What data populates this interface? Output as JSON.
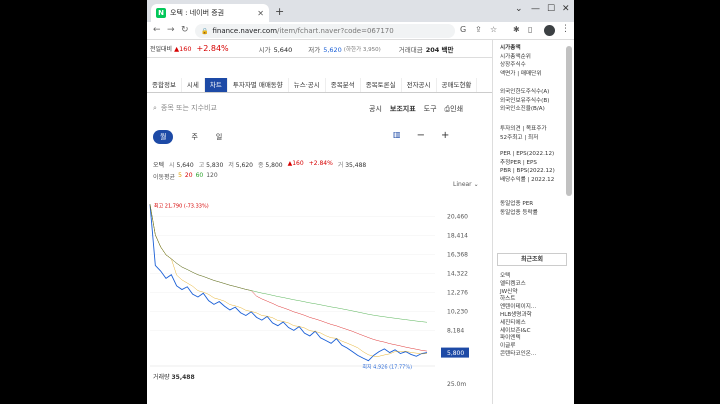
{
  "browser": {
    "tab_title": "오텍 : 네이버 증권",
    "favicon": "N",
    "url_host": "finance.naver.com",
    "url_path": "/item/fchart.naver?code=067170"
  },
  "stock_header": {
    "prev_label": "전일대비",
    "change_arrow": "▲",
    "change_value": "160",
    "change_pct": "+2.84%",
    "high_label": "시가",
    "high_value": "5,640",
    "low_label": "저가",
    "low_value": "5,620",
    "low_sub": "(하한가 3,950)",
    "volume_label": "거래대금",
    "volume_value": "204 백만"
  },
  "tabs": [
    "종합정보",
    "시세",
    "차트",
    "투자자별 매매동향",
    "뉴스·공시",
    "종목분석",
    "종목토론실",
    "전자공시",
    "공매도현황"
  ],
  "search": {
    "placeholder": "종목 또는 지수비교"
  },
  "toolbar": {
    "disclosure": "공시",
    "indicator": "보조지표",
    "tools": "도구",
    "print": "인쇄"
  },
  "period": {
    "month": "월",
    "week": "주",
    "day": "일"
  },
  "ohlc": {
    "name": "오텍",
    "open_label": "시",
    "open": "5,640",
    "high_label": "고",
    "high": "5,830",
    "low_label": "저",
    "low": "5,620",
    "close_label": "종",
    "close": "5,800",
    "change": "▲160",
    "change_pct": "+2.84%",
    "vol_label": "거",
    "vol": "35,488"
  },
  "ma": {
    "label": "이동평균",
    "p5": "5",
    "p20": "20",
    "p60": "60",
    "p120": "120"
  },
  "linear_label": "Linear",
  "volume_label": "거래량",
  "volume_value": "35,488",
  "colors": {
    "accent": "#1d4aa6",
    "up": "#d60000",
    "down": "#1a5fd6",
    "price_line": "#1a5fd6"
  },
  "chart_data": {
    "type": "line",
    "scale": "linear",
    "y_ticks": [
      20460,
      18414,
      16368,
      14322,
      12276,
      10230,
      8184
    ],
    "ylim": [
      5000,
      22800
    ],
    "current_price": "5,800",
    "max_annotation": "최고 21,790 (-73.33%)",
    "min_annotation": "최저 4,926 (17.77%)",
    "volume_tick": "25.0m",
    "series": [
      {
        "values": [
          21790,
          15200,
          14600,
          13800,
          14200,
          13000,
          12600,
          12900,
          12100,
          11800,
          12200,
          11400,
          11000,
          11300,
          10800,
          10400,
          10700,
          10100,
          9800,
          10200,
          9600,
          9300,
          9700,
          9000,
          8700,
          9100,
          8500,
          8200,
          8600,
          7900,
          7600,
          8100,
          7400,
          7100,
          6800,
          7300,
          6600,
          6300,
          5900,
          5500,
          5200,
          4926,
          5500,
          5900,
          6200,
          5800,
          6100,
          5700,
          5900,
          5600,
          5400,
          5700,
          5800
        ]
      }
    ]
  },
  "sidebar": {
    "block1": [
      "시가총액",
      "시가총액순위",
      "상장주식수",
      "액면가 | 매매단위"
    ],
    "block2": [
      "외국인한도주식수(A)",
      "외국인보유주식수(B)",
      "외국인소진율(B/A)"
    ],
    "block3": [
      "투자의견 | 목표주가",
      "52주최고 | 최저"
    ],
    "block4": [
      "PER | EPS(2022.12)",
      "추정PER | EPS",
      "PBR | BPS(2022.12)",
      "배당수익률 | 2022.12"
    ],
    "block5": [
      "동일업종 PER",
      "동일업종 등락률"
    ],
    "recent_title": "최근조회",
    "recent_items": [
      "오텍",
      "엘티켐코스",
      "JW신약",
      "하스트",
      "엔텐이테이지...",
      "HLB생명과학",
      "세진티에스",
      "세이브존I&C",
      "파이엔텍",
      "이글루",
      "콘텐타코인온..."
    ]
  }
}
